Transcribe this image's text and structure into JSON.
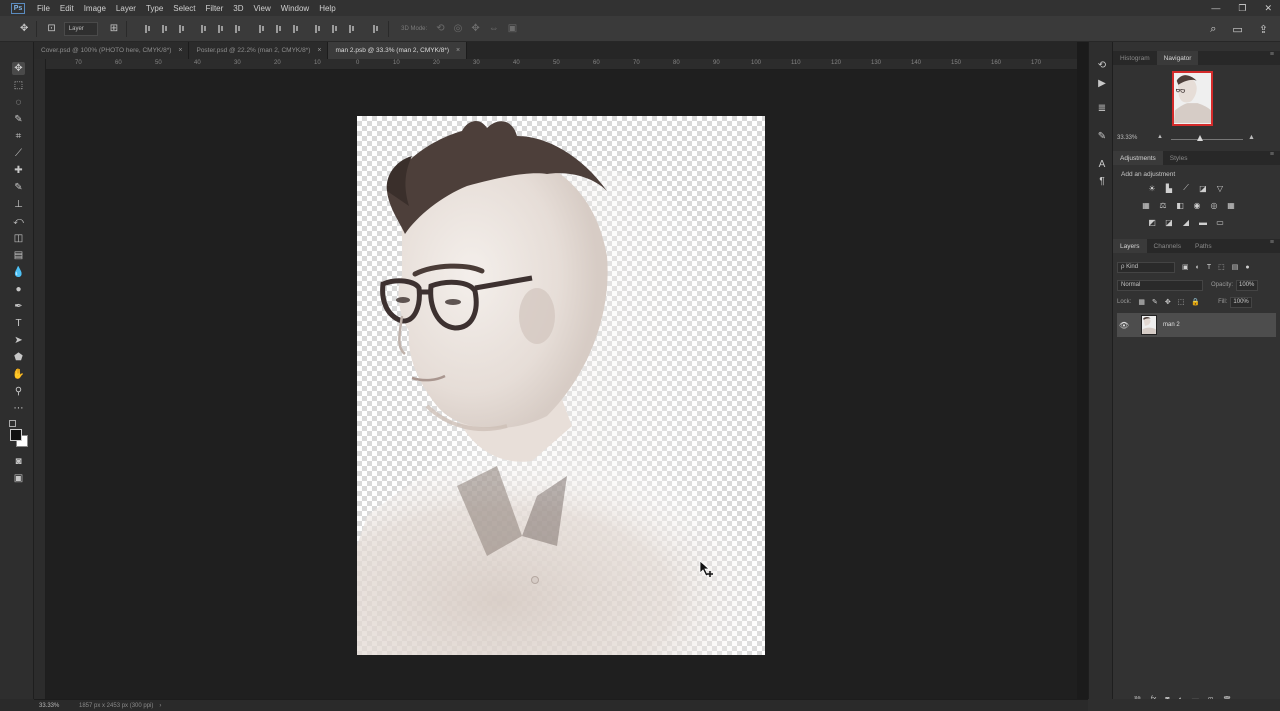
{
  "app": {
    "logo": "Ps"
  },
  "menu": [
    "File",
    "Edit",
    "Image",
    "Layer",
    "Type",
    "Select",
    "Filter",
    "3D",
    "View",
    "Window",
    "Help"
  ],
  "window_controls": {
    "minimize": "—",
    "maximize": "❐",
    "close": "✕"
  },
  "options_bar": {
    "auto_select_value": "Layer",
    "mode_3d_label": "3D Mode:"
  },
  "tabs": [
    {
      "label": "Cover.psd @ 100% (PHOTO here, CMYK/8*)",
      "close": "×"
    },
    {
      "label": "Poster.psd @ 22.2% (man 2, CMYK/8*)",
      "close": "×"
    },
    {
      "label": "man 2.psb @ 33.3% (man 2, CMYK/8*)",
      "close": "×"
    }
  ],
  "ruler_labels": [
    "70",
    "60",
    "50",
    "40",
    "30",
    "20",
    "10",
    "0",
    "10",
    "20",
    "30",
    "40",
    "50",
    "60",
    "70",
    "80",
    "90",
    "100",
    "110",
    "120",
    "130",
    "140",
    "150",
    "160",
    "170"
  ],
  "navigator": {
    "tabs": [
      "Histogram",
      "Navigator"
    ],
    "zoom": "33.33%"
  },
  "adjustments": {
    "tabs": [
      "Adjustments",
      "Styles"
    ],
    "label": "Add an adjustment"
  },
  "layers": {
    "tabs": [
      "Layers",
      "Channels",
      "Paths"
    ],
    "filter_kind": "ρ Kind",
    "blend_mode": "Normal",
    "opacity_label": "Opacity:",
    "opacity_value": "100%",
    "lock_label": "Lock:",
    "fill_label": "Fill:",
    "fill_value": "100%",
    "items": [
      {
        "name": "man 2",
        "visible": true
      }
    ]
  },
  "status": {
    "zoom": "33.33%",
    "doc_info": "1857 px x 2453 px (300 ppi)",
    "arrow": "›"
  },
  "colors": {
    "accent_selection": "#d42b2b",
    "panel_bg": "#323232",
    "canvas_bg": "#1f1f1f"
  }
}
